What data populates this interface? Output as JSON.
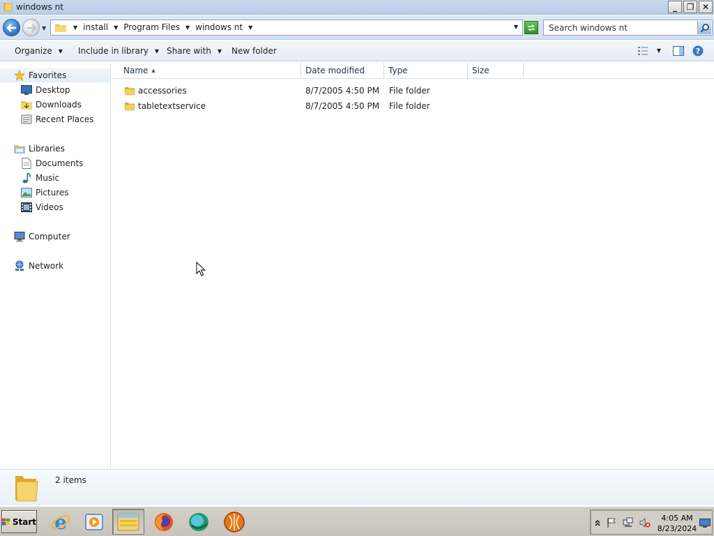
{
  "window": {
    "title": "windows nt",
    "buttons": {
      "minimize": "_",
      "restore": "❐",
      "close": "✕"
    }
  },
  "address": {
    "breadcrumbs": [
      "install",
      "Program Files",
      "windows nt"
    ],
    "search_placeholder": "Search windows nt"
  },
  "toolbar": {
    "organize": "Organize",
    "include_in_library": "Include in library",
    "share_with": "Share with",
    "new_folder": "New folder"
  },
  "navpane": {
    "favorites": {
      "label": "Favorites",
      "items": [
        "Desktop",
        "Downloads",
        "Recent Places"
      ]
    },
    "libraries": {
      "label": "Libraries",
      "items": [
        "Documents",
        "Music",
        "Pictures",
        "Videos"
      ]
    },
    "computer": "Computer",
    "network": "Network"
  },
  "filelist": {
    "columns": [
      "Name",
      "Date modified",
      "Type",
      "Size"
    ],
    "sort_column": "Name",
    "rows": [
      {
        "name": "accessories",
        "date": "8/7/2005 4:50 PM",
        "type": "File folder",
        "size": ""
      },
      {
        "name": "tabletextservice",
        "date": "8/7/2005 4:50 PM",
        "type": "File folder",
        "size": ""
      }
    ]
  },
  "details": {
    "item_count": "2 items"
  },
  "taskbar": {
    "start_label": "Start",
    "apps": [
      "internet-explorer",
      "media-player",
      "file-explorer",
      "firefox",
      "chrome-style-browser",
      "installer"
    ],
    "active_app": "file-explorer",
    "clock_time": "4:05 AM",
    "clock_date": "8/23/2024"
  },
  "colors": {
    "titlebar": "#c9d9ee",
    "accent_blue": "#2d6fbe",
    "folder_yellow": "#f3cf5c",
    "taskbar": "#d4d0c8"
  }
}
